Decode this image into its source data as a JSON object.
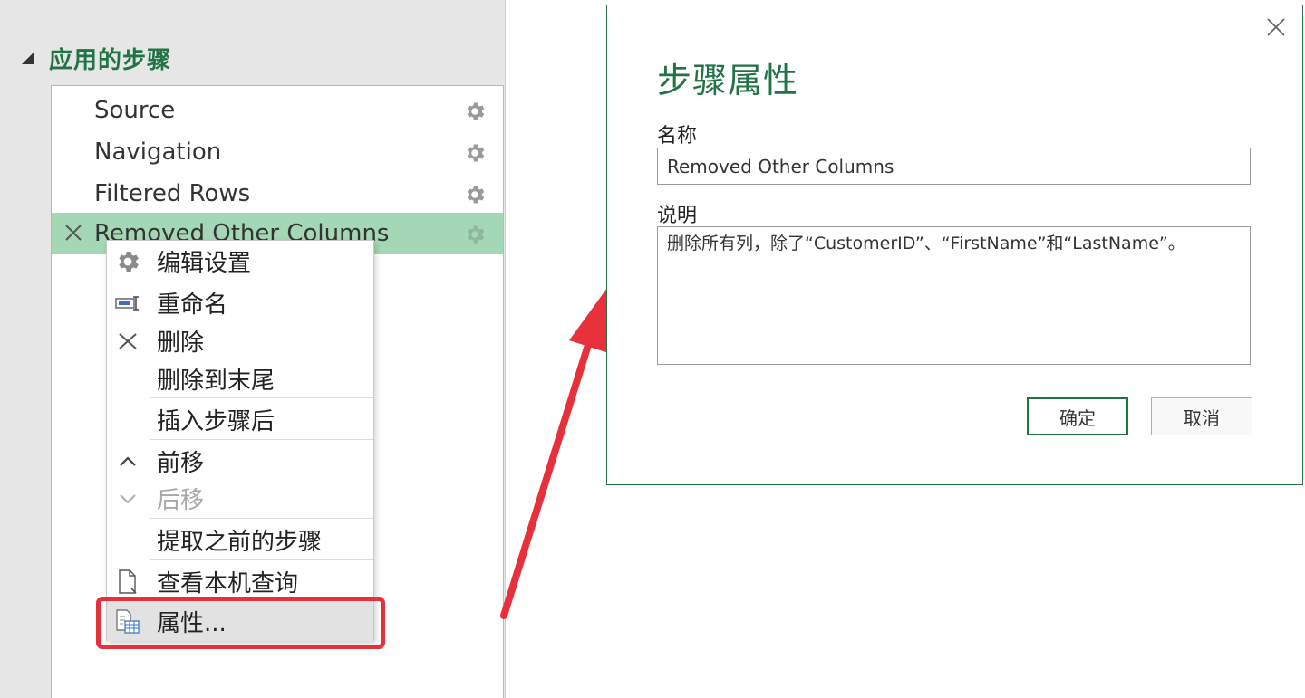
{
  "steps_pane": {
    "title": "应用的步骤",
    "steps": [
      {
        "label": "Source"
      },
      {
        "label": "Navigation"
      },
      {
        "label": "Filtered Rows"
      },
      {
        "label": "Removed Other Columns",
        "selected": true
      }
    ]
  },
  "context_menu": {
    "items": [
      {
        "label": "编辑设置",
        "icon": "gear-icon"
      },
      {
        "label": "重命名",
        "icon": "rename-icon"
      },
      {
        "label": "删除",
        "icon": "delete-x-icon"
      },
      {
        "label": "删除到末尾"
      },
      {
        "label": "插入步骤后"
      },
      {
        "label": "前移",
        "icon": "chevron-up-icon"
      },
      {
        "label": "后移",
        "icon": "chevron-down-icon",
        "disabled": true
      },
      {
        "label": "提取之前的步骤"
      },
      {
        "label": "查看本机查询",
        "icon": "document-icon"
      },
      {
        "label": "属性...",
        "icon": "properties-icon",
        "highlighted": true
      }
    ]
  },
  "dialog": {
    "title": "步骤属性",
    "name_label": "名称",
    "name_value": "Removed Other Columns",
    "description_label": "说明",
    "description_value": "删除所有列，除了“CustomerID”、“FirstName”和“LastName”。",
    "ok_label": "确定",
    "cancel_label": "取消"
  },
  "colors": {
    "accent_green": "#217346",
    "selected_row": "#a3d7b5",
    "highlight_red": "#e8303a"
  }
}
